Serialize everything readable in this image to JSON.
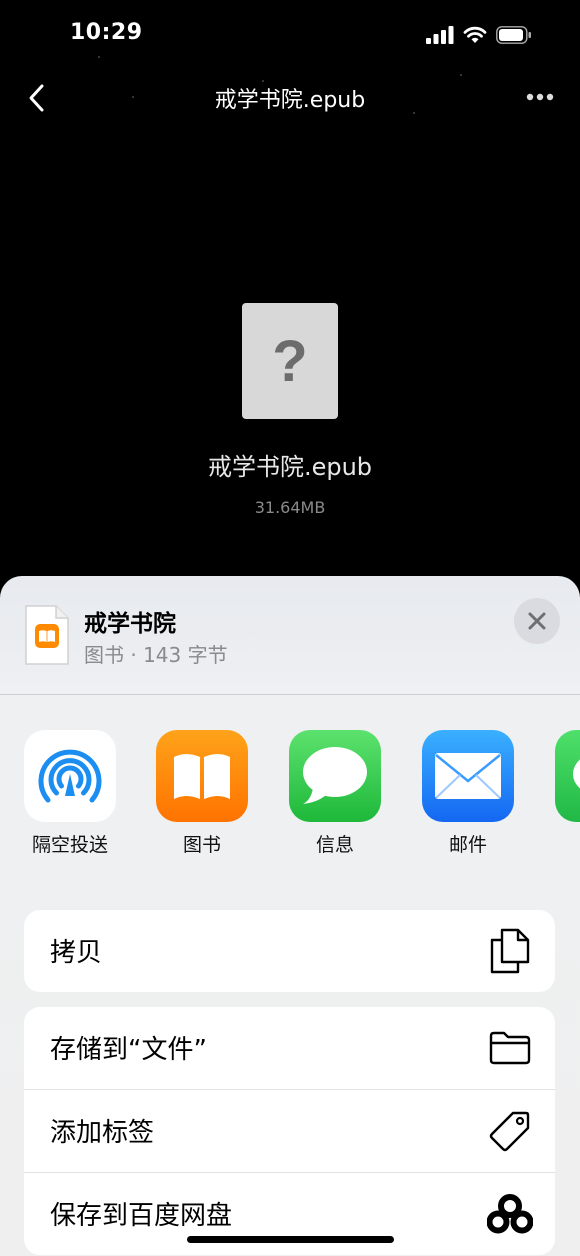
{
  "status_bar": {
    "time": "10:29"
  },
  "nav": {
    "title": "戒学书院.epub"
  },
  "preview": {
    "glyph": "?",
    "file_name": "戒学书院.epub",
    "file_size": "31.64MB"
  },
  "sheet": {
    "title": "戒学书院",
    "subtitle": "图书 · 143 字节",
    "apps": [
      {
        "label": "隔空投送",
        "icon": "airdrop-icon"
      },
      {
        "label": "图书",
        "icon": "books-icon"
      },
      {
        "label": "信息",
        "icon": "messages-icon"
      },
      {
        "label": "邮件",
        "icon": "mail-icon"
      }
    ],
    "actions_group1": [
      {
        "label": "拷贝",
        "icon": "copy-icon"
      }
    ],
    "actions_group2": [
      {
        "label": "存储到“文件”",
        "icon": "folder-icon"
      },
      {
        "label": "添加标签",
        "icon": "tag-icon"
      },
      {
        "label": "保存到百度网盘",
        "icon": "baidu-netdisk-icon"
      }
    ]
  },
  "colors": {
    "books_orange": "#FF8A00",
    "messages_green": "#34C759",
    "mail_blue": "#1E8BFF",
    "airdrop_blue": "#1C8EF1"
  }
}
